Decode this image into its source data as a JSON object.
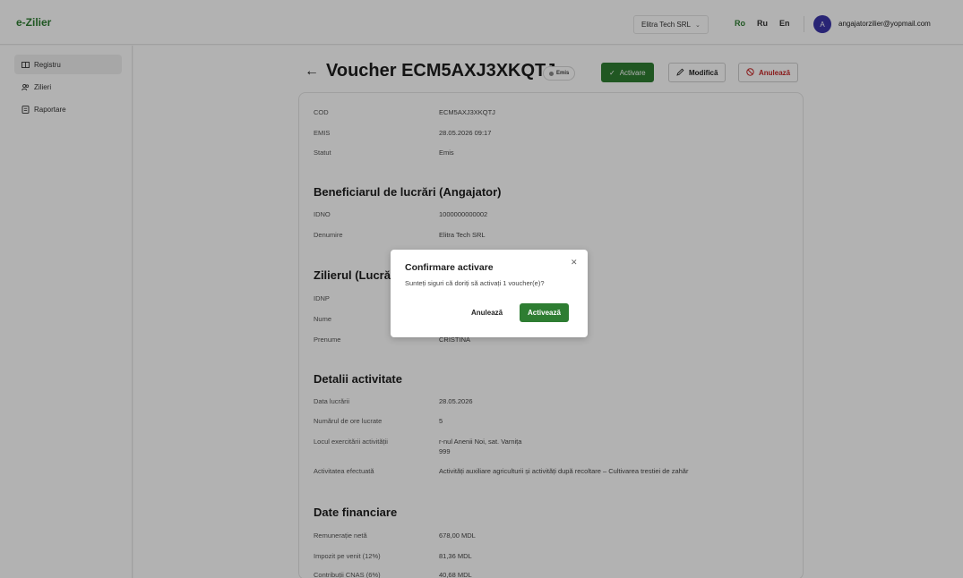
{
  "app": {
    "logo": "e-Zilier"
  },
  "header": {
    "company": "Elitra Tech SRL",
    "languages": [
      "Ro",
      "Ru",
      "En"
    ],
    "active_language": "Ro",
    "avatar_letter": "A",
    "user_email": "angajatorzilier@yopmail.com"
  },
  "sidebar": {
    "items": [
      {
        "label": "Registru",
        "icon": "register-icon",
        "active": true
      },
      {
        "label": "Zilieri",
        "icon": "users-icon",
        "active": false
      },
      {
        "label": "Raportare",
        "icon": "report-icon",
        "active": false
      }
    ]
  },
  "page": {
    "title": "Voucher ECM5AXJ3XKQTJ",
    "status_badge": "Emis",
    "actions": {
      "activate": "Activare",
      "modify": "Modifică",
      "cancel": "Anulează"
    }
  },
  "details": {
    "general": [
      {
        "label": "COD",
        "value": "ECM5AXJ3XKQTJ"
      },
      {
        "label": "EMIS",
        "value": "28.05.2026 09:17"
      },
      {
        "label": "Statut",
        "value": "Emis"
      }
    ],
    "employer": {
      "title": "Beneficiarul de lucrări (Angajator)",
      "rows": [
        {
          "label": "IDNO",
          "value": "1000000000002"
        },
        {
          "label": "Denumire",
          "value": "Elitra Tech SRL"
        }
      ]
    },
    "worker": {
      "title": "Zilierul (Lucrăt",
      "rows": [
        {
          "label": "IDNP",
          "value": ""
        },
        {
          "label": "Nume",
          "value": ""
        },
        {
          "label": "Prenume",
          "value": "CRISTINA"
        }
      ]
    },
    "activity": {
      "title": "Detalii activitate",
      "rows": [
        {
          "label": "Data lucrării",
          "value": "28.05.2026"
        },
        {
          "label": "Numărul de ore lucrate",
          "value": "5"
        },
        {
          "label": "Locul exercitării activității",
          "value": "r-nul Anenii Noi, sat. Varnița",
          "value2": "999"
        },
        {
          "label": "Activitatea efectuată",
          "value": "Activități auxiliare agriculturii și activități după recoltare – Cultivarea trestiei de zahăr"
        }
      ]
    },
    "financial": {
      "title": "Date financiare",
      "rows": [
        {
          "label": "Remunerație netă",
          "value": "678,00 MDL"
        },
        {
          "label": "Impozit pe venit (12%)",
          "value": "81,36 MDL"
        },
        {
          "label": "Contribuții CNAS (6%)",
          "value": "40,68 MDL"
        }
      ]
    }
  },
  "modal": {
    "title": "Confirmare activare",
    "message": "Sunteți siguri că doriți să activați 1 voucher(e)?",
    "cancel": "Anulează",
    "confirm": "Activează"
  },
  "colors": {
    "brand_green": "#2e7d32",
    "danger": "#c62828",
    "avatar": "#3b35a8"
  }
}
